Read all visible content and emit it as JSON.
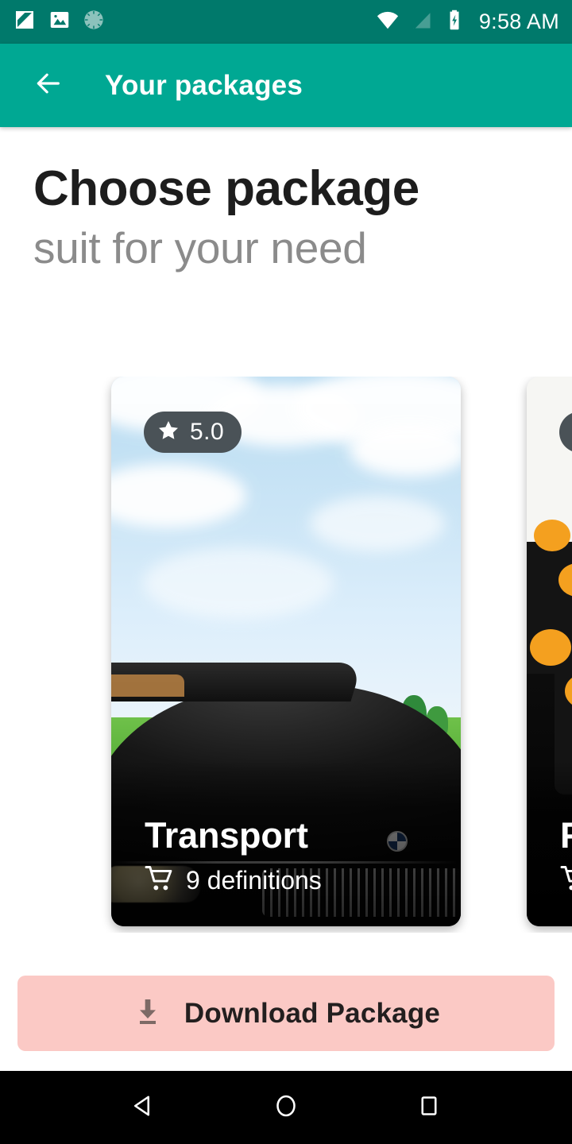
{
  "status_bar": {
    "clock": "9:58 AM",
    "background_color": "#00796b",
    "notification_icons": [
      {
        "name": "screenshot-icon"
      },
      {
        "name": "image-icon"
      },
      {
        "name": "sync-progress-icon"
      }
    ],
    "system_icons": [
      {
        "name": "wifi-icon"
      },
      {
        "name": "no-sim-signal-icon"
      },
      {
        "name": "battery-charging-icon"
      }
    ]
  },
  "app_bar": {
    "title": "Your packages",
    "back_icon": "arrow-left-icon",
    "background_color": "#00a893",
    "text_color": "#ffffff"
  },
  "heading": {
    "headline": "Choose package",
    "subhead": "suit for your need",
    "headline_color": "#1d1d1d",
    "subhead_color": "#8b8b8b"
  },
  "carousel": {
    "cards": [
      {
        "title": "Transport",
        "rating": "5.0",
        "rating_icon": "star-icon",
        "meta_icon": "shopping-cart-icon",
        "meta_text": "9 definitions",
        "image_subject": "black convertible car with city skyline"
      },
      {
        "title": "F",
        "rating": "",
        "rating_icon": "star-icon",
        "meta_icon": "shopping-cart-icon",
        "meta_text": "",
        "image_subject": "food plate with carrot flowers"
      }
    ],
    "badge_color": "#4a5257"
  },
  "download_button": {
    "label": "Download Package",
    "icon": "download-icon",
    "background_color": "#fbc9c5",
    "text_color": "#231f1f"
  },
  "nav_bar": {
    "background_color": "#000000",
    "buttons": [
      {
        "name": "nav-back-button",
        "icon": "triangle-left-icon"
      },
      {
        "name": "nav-home-button",
        "icon": "circle-icon"
      },
      {
        "name": "nav-recents-button",
        "icon": "square-icon"
      }
    ]
  }
}
